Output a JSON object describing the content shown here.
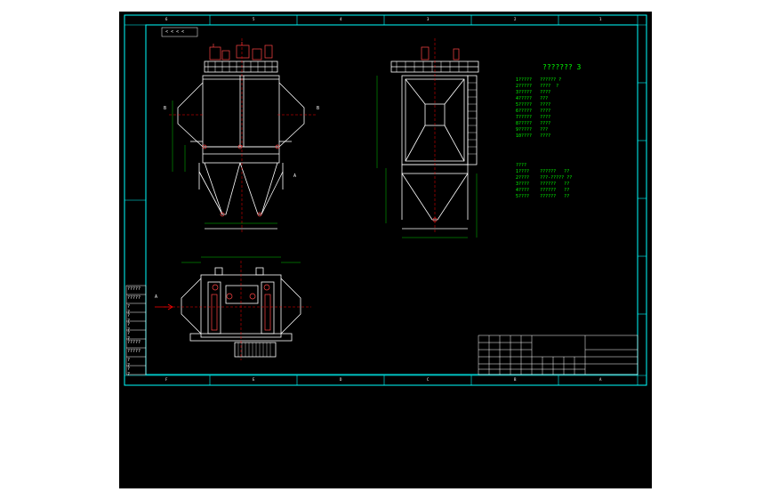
{
  "colors": {
    "background": "#000000",
    "frame": "#00ffff",
    "outline": "#ffffff",
    "text": "#00ff00",
    "centerline": "#ff0000",
    "equipment": "#ff00ff"
  },
  "title_block": {
    "left_tag": "< < < <",
    "tech_title": "???????  3"
  },
  "grid_labels": {
    "top": [
      "6",
      "5",
      "4",
      "3",
      "2",
      "1"
    ],
    "bottom": [
      "F",
      "E",
      "D",
      "C",
      "B",
      "A"
    ]
  },
  "tech_notes": [
    "1?????   ?????? ?",
    "2?????   ????  ?",
    "3?????   ????",
    "4?????   ???",
    "5?????   ????",
    "6?????   ????",
    "7?????   ????",
    "8?????   ????",
    "9?????   ???",
    "10????   ????"
  ],
  "tech_notes2": [
    "????",
    "1????    ??????   ??",
    "2????    ???-????? ??",
    "3????    ??????   ??",
    "4????    ??????   ??",
    "5????    ??????   ??"
  ],
  "left_table": [
    "?????",
    "?????",
    "? ?",
    "? ?",
    "? ?",
    "? ?",
    "?????",
    "?????",
    "? ?",
    "? ?"
  ],
  "view_labels": {
    "section_b_left": "B",
    "section_b_right": "B",
    "section_a": "A",
    "arrow_label": "A"
  }
}
